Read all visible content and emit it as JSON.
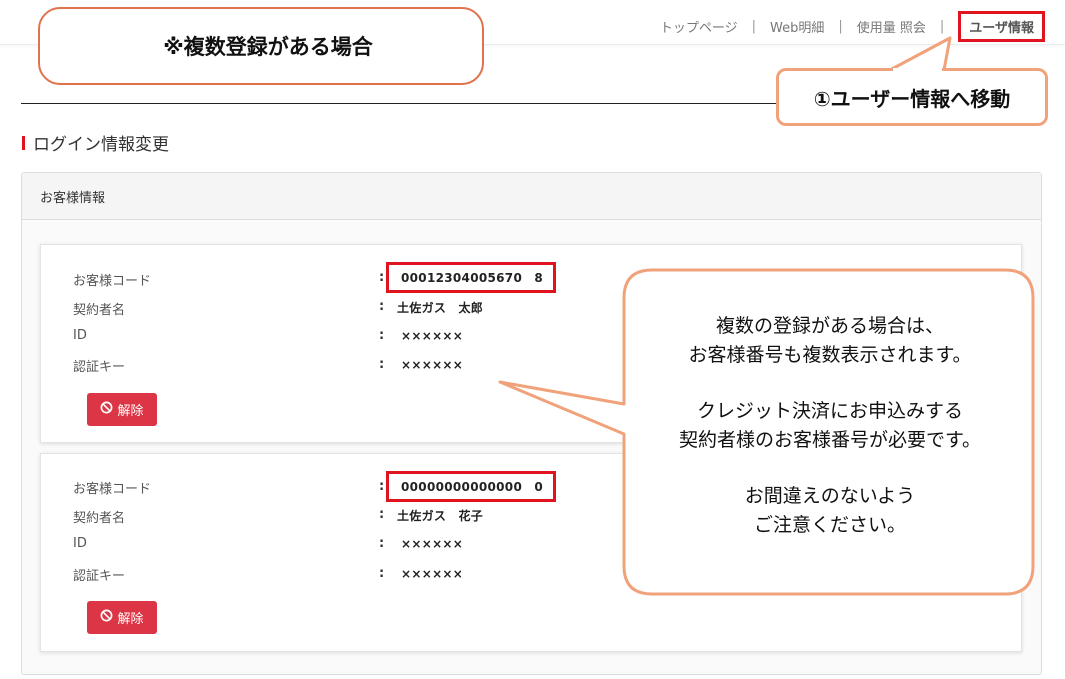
{
  "nav": {
    "items": [
      "トップページ",
      "Web明細",
      "使用量 照会",
      "ユーザ情報"
    ],
    "separator": "|"
  },
  "annotations": {
    "top_left": "※複数登録がある場合",
    "move": "①ユーザー情報へ移動",
    "main_lines": [
      "複数の登録がある場合は、",
      "お客様番号も複数表示されます。",
      "",
      "クレジット決済にお申込みする",
      "契約者様のお客様番号が必要です。",
      "",
      "お間違えのないよう",
      "ご注意ください。"
    ]
  },
  "page": {
    "section_title": "ログイン情報変更",
    "panel_header": "お客様情報",
    "field_labels": [
      "お客様コード",
      "契約者名",
      "ID",
      "認証キー"
    ],
    "colon": ":",
    "release_label": "解除"
  },
  "customers": [
    {
      "code": "00012304005670　8",
      "name": "土佐ガス　太郎",
      "id": "××××××",
      "auth_key": "××××××"
    },
    {
      "code": "00000000000000　0",
      "name": "土佐ガス　花子",
      "id": "××××××",
      "auth_key": "××××××"
    }
  ],
  "colors": {
    "accent_red": "#e0141e",
    "button_red": "#dc3545",
    "callout_border": "#f0a27a"
  }
}
